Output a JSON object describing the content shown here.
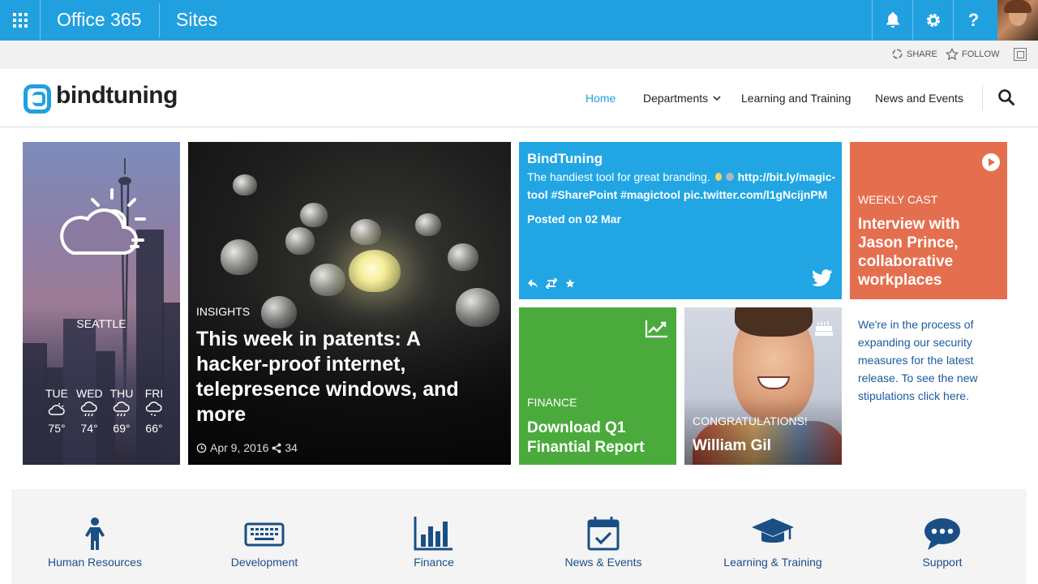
{
  "suitebar": {
    "app_title": "Office 365",
    "section": "Sites",
    "icons": [
      "waffle-icon",
      "bell-icon",
      "gear-icon",
      "help-icon"
    ],
    "help_glyph": "?",
    "color": "#21a0e0"
  },
  "ribbon": {
    "share_label": "SHARE",
    "follow_label": "FOLLOW"
  },
  "header": {
    "logo_text": "bindtuning",
    "nav": [
      {
        "label": "Home",
        "active": true
      },
      {
        "label": "Departments",
        "has_dropdown": true
      },
      {
        "label": "Learning and Training"
      },
      {
        "label": "News and Events"
      }
    ],
    "active_color": "#21a0e0"
  },
  "weather": {
    "city": "SEATTLE",
    "forecast": [
      {
        "day": "TUE",
        "temp": "75°",
        "icon": "partly-cloudy-icon"
      },
      {
        "day": "WED",
        "temp": "74°",
        "icon": "rain-icon"
      },
      {
        "day": "THU",
        "temp": "69°",
        "icon": "rain-icon"
      },
      {
        "day": "FRI",
        "temp": "66°",
        "icon": "drizzle-icon"
      }
    ]
  },
  "insights": {
    "category": "INSIGHTS",
    "title": "This week in patents: A hacker-proof internet, telepresence windows, and more",
    "date": "Apr 9, 2016",
    "shares": "34"
  },
  "twitter": {
    "author": "BindTuning",
    "text_plain": "The handiest tool for great branding. ",
    "link": "http://bit.ly/magic-tool",
    "hashtags": " #SharePoint #magictool pic.twitter.com/l1gNcijnPM",
    "posted": "Posted on 02 Mar",
    "color": "#21a6e3"
  },
  "weekly_cast": {
    "category": "WEEKLY CAST",
    "title": "Interview with Jason Prince, collaborative workplaces",
    "color": "#e46f4f"
  },
  "finance_tile": {
    "category": "FINANCE",
    "title": "Download Q1 Finantial Report",
    "color": "#4aab3c"
  },
  "congrats_tile": {
    "category": "CONGRATULATIONS!",
    "name": "William Gil"
  },
  "notice": {
    "text": "We're in the process of expanding our security measures for the latest release. To see the new stipulations click here."
  },
  "quicklinks": [
    {
      "label": "Human Resources",
      "icon": "person-icon"
    },
    {
      "label": "Development",
      "icon": "keyboard-icon"
    },
    {
      "label": "Finance",
      "icon": "bar-chart-icon"
    },
    {
      "label": "News & Events",
      "icon": "calendar-check-icon"
    },
    {
      "label": "Learning & Training",
      "icon": "graduation-cap-icon"
    },
    {
      "label": "Support",
      "icon": "chat-bubble-icon"
    }
  ],
  "quicklink_color": "#1a4f86"
}
